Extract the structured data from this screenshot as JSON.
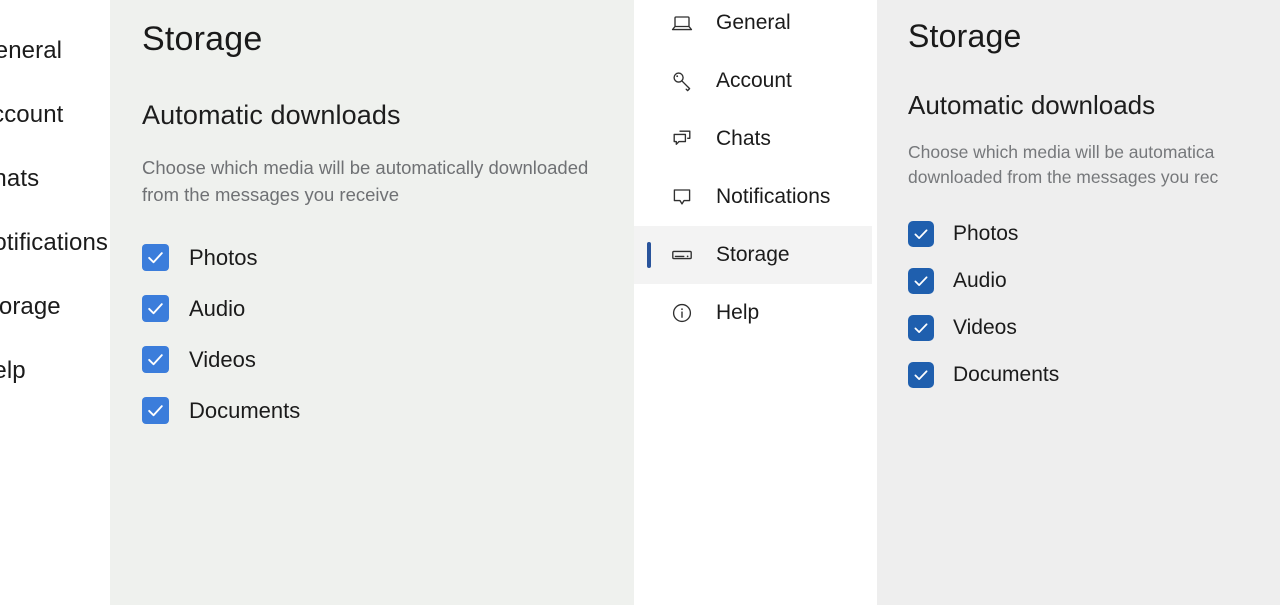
{
  "colors": {
    "panel_a_bg": "#eff1ee",
    "panel_b_bg": "#eeeeee",
    "nav_bg": "#ffffff",
    "checkbox_a": "#3b7ddb",
    "checkbox_b": "#1f5fae",
    "accent_bar": "#29539b",
    "selected_row_bg": "#f3f3f3",
    "title_text": "#1a1a1a",
    "muted_text": "#6f7174"
  },
  "left_strip": {
    "items": [
      {
        "label": "General",
        "visible_text": "eral"
      },
      {
        "label": "Account",
        "visible_text": "ount"
      },
      {
        "label": "Chats",
        "visible_text": "ts"
      },
      {
        "label": "Notifications",
        "visible_text": "ifications"
      },
      {
        "label": "Storage",
        "visible_text": "age"
      },
      {
        "label": "Help",
        "visible_text": "p"
      }
    ]
  },
  "settings_a": {
    "page_title": "Storage",
    "section_title": "Automatic downloads",
    "section_desc": "Choose which media will be automatically downloaded from the messages you receive",
    "options": [
      {
        "label": "Photos",
        "checked": true
      },
      {
        "label": "Audio",
        "checked": true
      },
      {
        "label": "Videos",
        "checked": true
      },
      {
        "label": "Documents",
        "checked": true
      }
    ]
  },
  "nav": {
    "items": [
      {
        "label": "General",
        "icon": "laptop-icon",
        "selected": false
      },
      {
        "label": "Account",
        "icon": "key-icon",
        "selected": false
      },
      {
        "label": "Chats",
        "icon": "chat-bubbles-icon",
        "selected": false
      },
      {
        "label": "Notifications",
        "icon": "speech-bubble-icon",
        "selected": false
      },
      {
        "label": "Storage",
        "icon": "hard-drive-icon",
        "selected": true
      },
      {
        "label": "Help",
        "icon": "info-circle-icon",
        "selected": false
      }
    ]
  },
  "settings_b": {
    "page_title": "Storage",
    "section_title": "Automatic downloads",
    "section_desc_line1": "Choose which media will be automatica",
    "section_desc_line2": "downloaded from the messages you rec",
    "options": [
      {
        "label": "Photos",
        "checked": true
      },
      {
        "label": "Audio",
        "checked": true
      },
      {
        "label": "Videos",
        "checked": true
      },
      {
        "label": "Documents",
        "checked": true
      }
    ]
  }
}
